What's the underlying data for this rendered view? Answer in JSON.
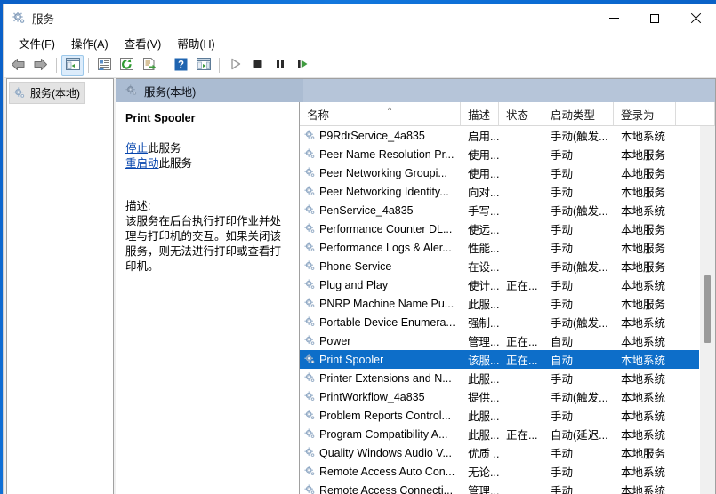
{
  "window": {
    "title": "服务",
    "app_icon": "services-gear-icon",
    "controls": {
      "minimize": "最小化",
      "maximize": "最大化",
      "close": "关闭"
    }
  },
  "menubar": {
    "items": [
      {
        "label": "文件(F)",
        "name": "menu-file"
      },
      {
        "label": "操作(A)",
        "name": "menu-action"
      },
      {
        "label": "查看(V)",
        "name": "menu-view"
      },
      {
        "label": "帮助(H)",
        "name": "menu-help"
      }
    ]
  },
  "toolbar": {
    "buttons": [
      {
        "name": "back-icon",
        "glyph": "arrow-left",
        "active": false
      },
      {
        "name": "forward-icon",
        "glyph": "arrow-right",
        "active": false
      },
      {
        "name": "show-tree-icon",
        "glyph": "panel",
        "active": true
      },
      {
        "name": "properties-icon",
        "glyph": "properties",
        "active": false
      },
      {
        "name": "refresh-icon",
        "glyph": "refresh",
        "active": false
      },
      {
        "name": "export-list-icon",
        "glyph": "export",
        "active": false
      },
      {
        "name": "help-icon",
        "glyph": "help",
        "active": false
      },
      {
        "name": "show-details-icon",
        "glyph": "details",
        "active": false
      },
      {
        "name": "start-service-icon",
        "glyph": "play",
        "active": false
      },
      {
        "name": "stop-service-icon",
        "glyph": "stop",
        "active": false
      },
      {
        "name": "pause-service-icon",
        "glyph": "pause",
        "active": false
      },
      {
        "name": "restart-service-icon",
        "glyph": "restart",
        "active": false
      }
    ]
  },
  "tree": {
    "items": [
      {
        "label": "服务(本地)",
        "icon": "services-gear-icon",
        "selected": true
      }
    ]
  },
  "banner": {
    "label": "服务(本地)",
    "icon": "services-gear-icon"
  },
  "details": {
    "service_name": "Print Spooler",
    "links": [
      {
        "link_text": "停止",
        "suffix": "此服务",
        "name": "stop-service-link"
      },
      {
        "link_text": "重启动",
        "suffix": "此服务",
        "name": "restart-service-link"
      }
    ],
    "description_label": "描述:",
    "description_text": "该服务在后台执行打印作业并处理与打印机的交互。如果关闭该服务，则无法进行打印或查看打印机。"
  },
  "list": {
    "columns": [
      {
        "key": "name",
        "label": "名称",
        "sorted": true,
        "sort_dir": "asc"
      },
      {
        "key": "desc",
        "label": "描述",
        "sorted": false
      },
      {
        "key": "state",
        "label": "状态",
        "sorted": false
      },
      {
        "key": "start",
        "label": "启动类型",
        "sorted": false
      },
      {
        "key": "logon",
        "label": "登录为",
        "sorted": false
      }
    ],
    "selected_index": 12,
    "rows": [
      {
        "name": "P9RdrService_4a835",
        "desc": "启用...",
        "state": "",
        "start": "手动(触发...",
        "logon": "本地系统"
      },
      {
        "name": "Peer Name Resolution Pr...",
        "desc": "使用...",
        "state": "",
        "start": "手动",
        "logon": "本地服务"
      },
      {
        "name": "Peer Networking Groupi...",
        "desc": "使用...",
        "state": "",
        "start": "手动",
        "logon": "本地服务"
      },
      {
        "name": "Peer Networking Identity...",
        "desc": "向对...",
        "state": "",
        "start": "手动",
        "logon": "本地服务"
      },
      {
        "name": "PenService_4a835",
        "desc": "手写...",
        "state": "",
        "start": "手动(触发...",
        "logon": "本地系统"
      },
      {
        "name": "Performance Counter DL...",
        "desc": "使远...",
        "state": "",
        "start": "手动",
        "logon": "本地服务"
      },
      {
        "name": "Performance Logs & Aler...",
        "desc": "性能...",
        "state": "",
        "start": "手动",
        "logon": "本地服务"
      },
      {
        "name": "Phone Service",
        "desc": "在设...",
        "state": "",
        "start": "手动(触发...",
        "logon": "本地服务"
      },
      {
        "name": "Plug and Play",
        "desc": "使计...",
        "state": "正在...",
        "start": "手动",
        "logon": "本地系统"
      },
      {
        "name": "PNRP Machine Name Pu...",
        "desc": "此服...",
        "state": "",
        "start": "手动",
        "logon": "本地服务"
      },
      {
        "name": "Portable Device Enumera...",
        "desc": "强制...",
        "state": "",
        "start": "手动(触发...",
        "logon": "本地系统"
      },
      {
        "name": "Power",
        "desc": "管理...",
        "state": "正在...",
        "start": "自动",
        "logon": "本地系统"
      },
      {
        "name": "Print Spooler",
        "desc": "该服...",
        "state": "正在...",
        "start": "自动",
        "logon": "本地系统"
      },
      {
        "name": "Printer Extensions and N...",
        "desc": "此服...",
        "state": "",
        "start": "手动",
        "logon": "本地系统"
      },
      {
        "name": "PrintWorkflow_4a835",
        "desc": "提供...",
        "state": "",
        "start": "手动(触发...",
        "logon": "本地系统"
      },
      {
        "name": "Problem Reports Control...",
        "desc": "此服...",
        "state": "",
        "start": "手动",
        "logon": "本地系统"
      },
      {
        "name": "Program Compatibility A...",
        "desc": "此服...",
        "state": "正在...",
        "start": "自动(延迟...",
        "logon": "本地系统"
      },
      {
        "name": "Quality Windows Audio V...",
        "desc": "优质 ...",
        "state": "",
        "start": "手动",
        "logon": "本地服务"
      },
      {
        "name": "Remote Access Auto Con...",
        "desc": "无论...",
        "state": "",
        "start": "手动",
        "logon": "本地系统"
      },
      {
        "name": "Remote Access Connecti...",
        "desc": "管理...",
        "state": "",
        "start": "手动",
        "logon": "本地系统"
      }
    ]
  },
  "colors": {
    "selection_blue": "#0d6ec9",
    "banner_blue": "#abbcd2",
    "link_blue": "#0645ad",
    "desktop_blue": "#0b63c9"
  }
}
